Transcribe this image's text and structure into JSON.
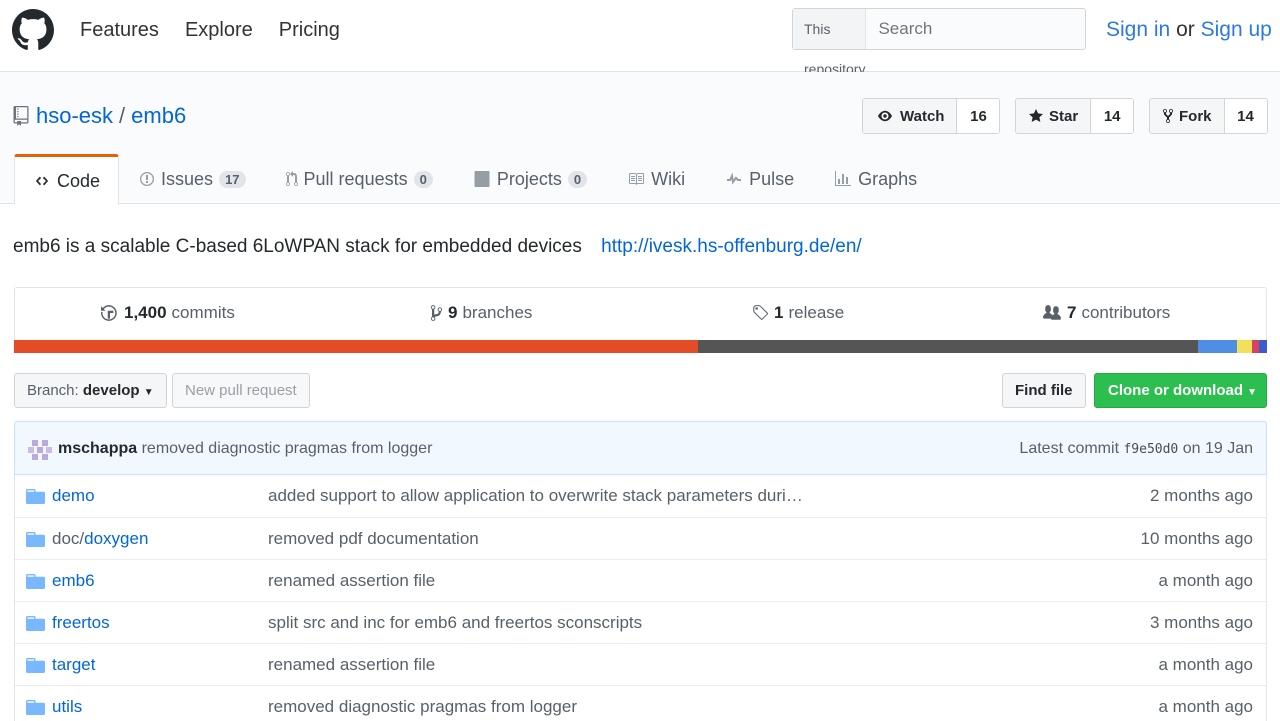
{
  "header": {
    "nav": [
      "Features",
      "Explore",
      "Pricing"
    ],
    "search_scope": "This repository",
    "search_placeholder": "Search",
    "signin": "Sign in",
    "or": "or",
    "signup": "Sign up"
  },
  "repo": {
    "owner": "hso-esk",
    "separator": "/",
    "name": "emb6",
    "watch_label": "Watch",
    "watch_count": "16",
    "star_label": "Star",
    "star_count": "14",
    "fork_label": "Fork",
    "fork_count": "14"
  },
  "tabs": [
    {
      "label": "Code",
      "icon": "code-icon"
    },
    {
      "label": "Issues",
      "counter": "17",
      "icon": "issue-icon"
    },
    {
      "label": "Pull requests",
      "counter": "0",
      "icon": "pull-request-icon"
    },
    {
      "label": "Projects",
      "counter": "0",
      "icon": "project-icon"
    },
    {
      "label": "Wiki",
      "icon": "book-icon"
    },
    {
      "label": "Pulse",
      "icon": "pulse-icon"
    },
    {
      "label": "Graphs",
      "icon": "graph-icon"
    }
  ],
  "description": {
    "text": "emb6 is a scalable C-based 6LoWPAN stack for embedded devices",
    "url": "http://ivesk.hs-offenburg.de/en/"
  },
  "summary": {
    "commits_num": "1,400",
    "commits_label": "commits",
    "branches_num": "9",
    "branches_label": "branches",
    "releases_num": "1",
    "releases_label": "release",
    "contributors_num": "7",
    "contributors_label": "contributors"
  },
  "languages": [
    {
      "color": "#e34c26",
      "share": 54.6
    },
    {
      "color": "#555555",
      "share": 39.9
    },
    {
      "color": "#4f8fe3",
      "share": 3.1
    },
    {
      "color": "#f1e05a",
      "share": 1.2
    },
    {
      "color": "#d7435e",
      "share": 0.6
    },
    {
      "color": "#3a5ccc",
      "share": 0.6
    }
  ],
  "filenav": {
    "branch_prefix": "Branch:",
    "branch_name": "develop",
    "new_pr": "New pull request",
    "find_file": "Find file",
    "clone": "Clone or download"
  },
  "commit": {
    "author": "mschappa",
    "message": "removed diagnostic pragmas from logger",
    "latest_label": "Latest commit",
    "sha": "f9e50d0",
    "date": "on 19 Jan"
  },
  "files": [
    {
      "dir": "",
      "name": "demo",
      "message": "added support to allow application to overwrite stack parameters duri…",
      "age": "2 months ago"
    },
    {
      "dir": "doc/",
      "name": "doxygen",
      "message": "removed pdf documentation",
      "age": "10 months ago"
    },
    {
      "dir": "",
      "name": "emb6",
      "message": "renamed assertion file",
      "age": "a month ago"
    },
    {
      "dir": "",
      "name": "freertos",
      "message": "split src and inc for emb6 and freertos sconscripts",
      "age": "3 months ago"
    },
    {
      "dir": "",
      "name": "target",
      "message": "renamed assertion file",
      "age": "a month ago"
    },
    {
      "dir": "",
      "name": "utils",
      "message": "removed diagnostic pragmas from logger",
      "age": "a month ago"
    }
  ]
}
